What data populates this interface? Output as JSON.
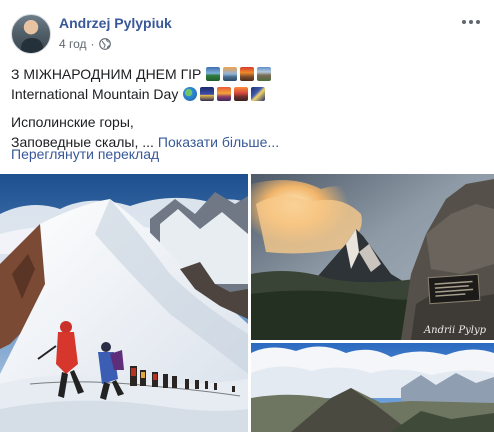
{
  "post": {
    "author": "Andrzej Pylypiuk",
    "time": "4 год",
    "privacy_icon": "globe-icon",
    "menu_icon": "more-options-icon"
  },
  "content": {
    "line1": "З МІЖНАРОДНИМ ДНЕМ ГІР",
    "line2": "International Mountain Day",
    "line3": "Исполинские горы,",
    "line4": "Заповедные скалы, ...",
    "see_more": "Показати більше...",
    "translate": "Переглянути переклад",
    "emoji_row1": [
      "mountain-sunrise-emoji",
      "mountain-sunrise-emoji",
      "volcano-emoji",
      "mountain-emoji"
    ],
    "emoji_row2": [
      "globe-emoji",
      "night-city-emoji",
      "sunrise-emoji",
      "mountain-emoji",
      "milky-way-emoji"
    ]
  },
  "photos": {
    "watermark": "Andrii Pylyp"
  },
  "colors": {
    "link": "#385898",
    "secondary_text": "#606770",
    "primary_text": "#1c1e21"
  }
}
